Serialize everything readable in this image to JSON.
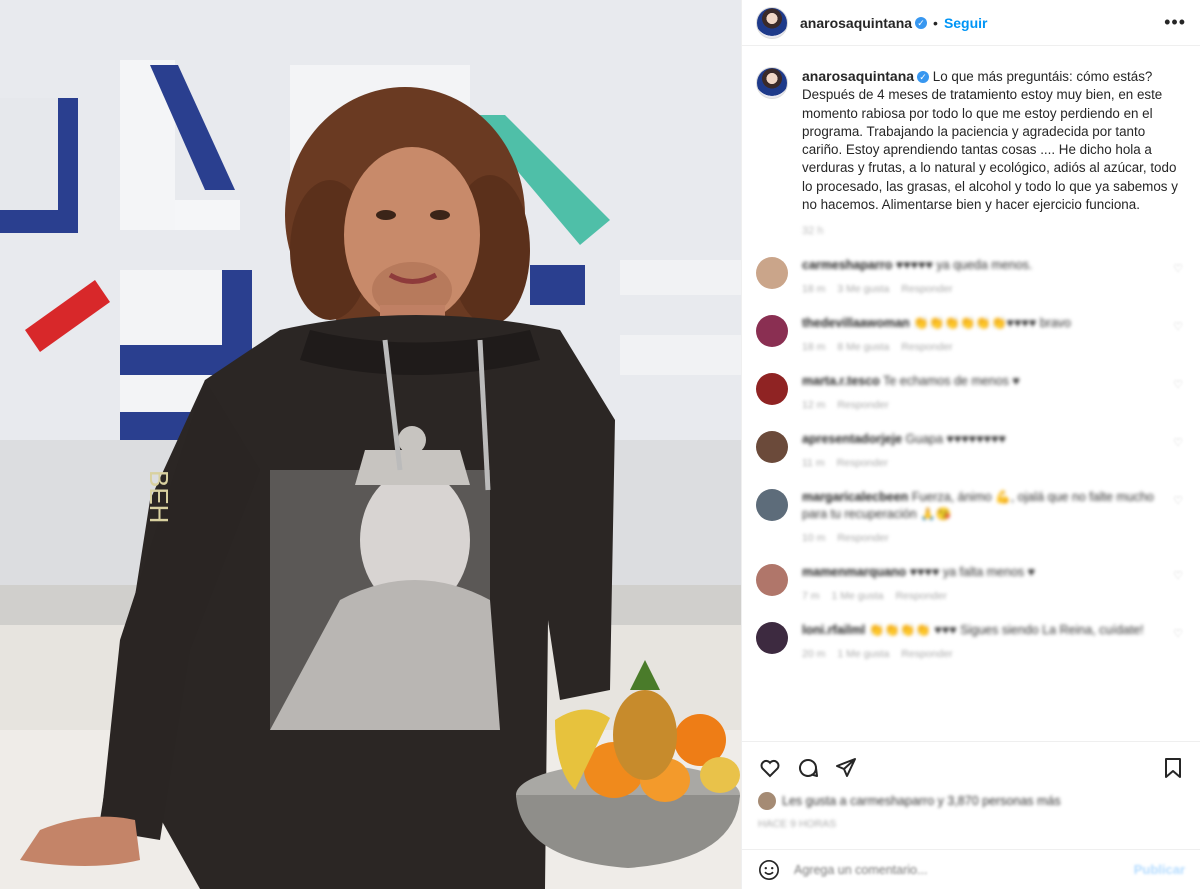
{
  "post": {
    "username": "anarosaquintana",
    "verified_icon": "verified-badge-icon",
    "separator": "•",
    "follow_label": "Seguir",
    "more_icon": "more-options-icon",
    "more_label": "•••"
  },
  "caption": {
    "username": "anarosaquintana",
    "text": "Lo que más preguntáis: cómo estás? Después de 4 meses de tratamiento estoy muy bien, en este momento rabiosa por todo lo que me estoy perdiendo en el programa. Trabajando la paciencia y agradecida por tanto cariño. Estoy aprendiendo tantas cosas .... He dicho hola a verduras y frutas, a lo natural y ecológico, adiós al azúcar, todo lo procesado, las grasas, el alcohol y todo lo que ya sabemos y no hacemos. Alimentarse bien y hacer ejercicio funciona.",
    "time": "32 h"
  },
  "comments": [
    {
      "user": "carmeshaparro",
      "text": "♥♥♥♥♥ ya queda menos.",
      "meta": [
        "18 m",
        "3 Me gusta",
        "Responder"
      ],
      "avatar_color": "#caa58a"
    },
    {
      "user": "thedevillaawoman",
      "text": "👏👏👏👏👏👏♥♥♥♥ bravo",
      "meta": [
        "18 m",
        "8 Me gusta",
        "Responder"
      ],
      "avatar_color": "#8a2f52"
    },
    {
      "user": "marta.r.tesco",
      "text": "Te echamos de menos ♥",
      "meta": [
        "12 m",
        "Responder"
      ],
      "avatar_color": "#8f2323"
    },
    {
      "user": "apresentadorjeje",
      "text": "Guapa ♥♥♥♥♥♥♥♥",
      "meta": [
        "11 m",
        "Responder"
      ],
      "avatar_color": "#6b4a3a"
    },
    {
      "user": "margaricalecbeen",
      "text": "Fuerza, ánimo 💪, ojalá que no falte mucho para tu recuperación 🙏😘",
      "meta": [
        "10 m",
        "Responder"
      ],
      "avatar_color": "#5d6c7a"
    },
    {
      "user": "mamenmarquano",
      "text": "♥♥♥♥ ya falta menos ♥",
      "meta": [
        "7 m",
        "1 Me gusta",
        "Responder"
      ],
      "avatar_color": "#b0766a"
    },
    {
      "user": "loni.rfailml",
      "text": "👏👏👏👏 ♥♥♥ Sigues siendo La Reina, cuídate!",
      "meta": [
        "20 m",
        "1 Me gusta",
        "Responder"
      ],
      "avatar_color": "#3d2a40"
    }
  ],
  "actions": {
    "like_icon": "heart-icon",
    "comment_icon": "comment-icon",
    "share_icon": "share-icon",
    "save_icon": "bookmark-icon"
  },
  "likes": {
    "text": "Les gusta a carmeshaparro y 3,870 personas más",
    "date": "HACE 9 HORAS"
  },
  "add_comment": {
    "placeholder": "Agrega un comentario...",
    "publish_label": "Publicar",
    "emoji_icon": "emoji-icon"
  },
  "colors": {
    "accent": "#0095f6",
    "verified": "#3897f0",
    "heart": "#e0245e"
  }
}
